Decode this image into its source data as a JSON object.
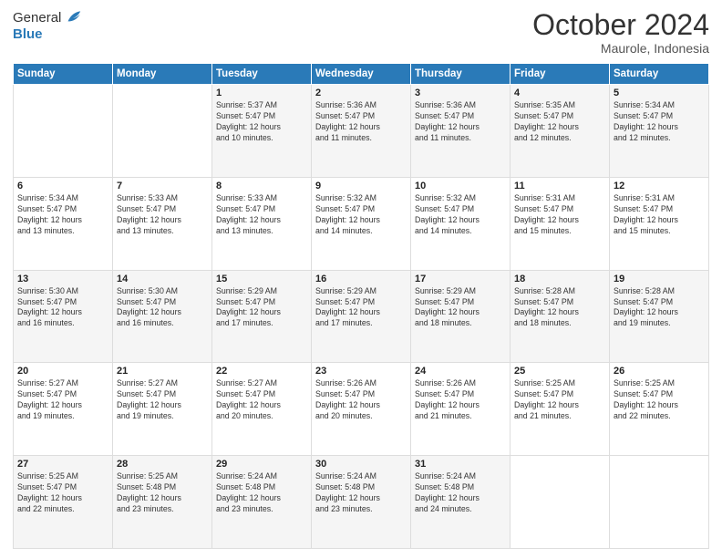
{
  "logo": {
    "text_general": "General",
    "text_blue": "Blue"
  },
  "header": {
    "month": "October 2024",
    "location": "Maurole, Indonesia"
  },
  "days_of_week": [
    "Sunday",
    "Monday",
    "Tuesday",
    "Wednesday",
    "Thursday",
    "Friday",
    "Saturday"
  ],
  "weeks": [
    [
      {
        "day": "",
        "sunrise": "",
        "sunset": "",
        "daylight": ""
      },
      {
        "day": "",
        "sunrise": "",
        "sunset": "",
        "daylight": ""
      },
      {
        "day": "1",
        "sunrise": "Sunrise: 5:37 AM",
        "sunset": "Sunset: 5:47 PM",
        "daylight": "Daylight: 12 hours and 10 minutes."
      },
      {
        "day": "2",
        "sunrise": "Sunrise: 5:36 AM",
        "sunset": "Sunset: 5:47 PM",
        "daylight": "Daylight: 12 hours and 11 minutes."
      },
      {
        "day": "3",
        "sunrise": "Sunrise: 5:36 AM",
        "sunset": "Sunset: 5:47 PM",
        "daylight": "Daylight: 12 hours and 11 minutes."
      },
      {
        "day": "4",
        "sunrise": "Sunrise: 5:35 AM",
        "sunset": "Sunset: 5:47 PM",
        "daylight": "Daylight: 12 hours and 12 minutes."
      },
      {
        "day": "5",
        "sunrise": "Sunrise: 5:34 AM",
        "sunset": "Sunset: 5:47 PM",
        "daylight": "Daylight: 12 hours and 12 minutes."
      }
    ],
    [
      {
        "day": "6",
        "sunrise": "Sunrise: 5:34 AM",
        "sunset": "Sunset: 5:47 PM",
        "daylight": "Daylight: 12 hours and 13 minutes."
      },
      {
        "day": "7",
        "sunrise": "Sunrise: 5:33 AM",
        "sunset": "Sunset: 5:47 PM",
        "daylight": "Daylight: 12 hours and 13 minutes."
      },
      {
        "day": "8",
        "sunrise": "Sunrise: 5:33 AM",
        "sunset": "Sunset: 5:47 PM",
        "daylight": "Daylight: 12 hours and 13 minutes."
      },
      {
        "day": "9",
        "sunrise": "Sunrise: 5:32 AM",
        "sunset": "Sunset: 5:47 PM",
        "daylight": "Daylight: 12 hours and 14 minutes."
      },
      {
        "day": "10",
        "sunrise": "Sunrise: 5:32 AM",
        "sunset": "Sunset: 5:47 PM",
        "daylight": "Daylight: 12 hours and 14 minutes."
      },
      {
        "day": "11",
        "sunrise": "Sunrise: 5:31 AM",
        "sunset": "Sunset: 5:47 PM",
        "daylight": "Daylight: 12 hours and 15 minutes."
      },
      {
        "day": "12",
        "sunrise": "Sunrise: 5:31 AM",
        "sunset": "Sunset: 5:47 PM",
        "daylight": "Daylight: 12 hours and 15 minutes."
      }
    ],
    [
      {
        "day": "13",
        "sunrise": "Sunrise: 5:30 AM",
        "sunset": "Sunset: 5:47 PM",
        "daylight": "Daylight: 12 hours and 16 minutes."
      },
      {
        "day": "14",
        "sunrise": "Sunrise: 5:30 AM",
        "sunset": "Sunset: 5:47 PM",
        "daylight": "Daylight: 12 hours and 16 minutes."
      },
      {
        "day": "15",
        "sunrise": "Sunrise: 5:29 AM",
        "sunset": "Sunset: 5:47 PM",
        "daylight": "Daylight: 12 hours and 17 minutes."
      },
      {
        "day": "16",
        "sunrise": "Sunrise: 5:29 AM",
        "sunset": "Sunset: 5:47 PM",
        "daylight": "Daylight: 12 hours and 17 minutes."
      },
      {
        "day": "17",
        "sunrise": "Sunrise: 5:29 AM",
        "sunset": "Sunset: 5:47 PM",
        "daylight": "Daylight: 12 hours and 18 minutes."
      },
      {
        "day": "18",
        "sunrise": "Sunrise: 5:28 AM",
        "sunset": "Sunset: 5:47 PM",
        "daylight": "Daylight: 12 hours and 18 minutes."
      },
      {
        "day": "19",
        "sunrise": "Sunrise: 5:28 AM",
        "sunset": "Sunset: 5:47 PM",
        "daylight": "Daylight: 12 hours and 19 minutes."
      }
    ],
    [
      {
        "day": "20",
        "sunrise": "Sunrise: 5:27 AM",
        "sunset": "Sunset: 5:47 PM",
        "daylight": "Daylight: 12 hours and 19 minutes."
      },
      {
        "day": "21",
        "sunrise": "Sunrise: 5:27 AM",
        "sunset": "Sunset: 5:47 PM",
        "daylight": "Daylight: 12 hours and 19 minutes."
      },
      {
        "day": "22",
        "sunrise": "Sunrise: 5:27 AM",
        "sunset": "Sunset: 5:47 PM",
        "daylight": "Daylight: 12 hours and 20 minutes."
      },
      {
        "day": "23",
        "sunrise": "Sunrise: 5:26 AM",
        "sunset": "Sunset: 5:47 PM",
        "daylight": "Daylight: 12 hours and 20 minutes."
      },
      {
        "day": "24",
        "sunrise": "Sunrise: 5:26 AM",
        "sunset": "Sunset: 5:47 PM",
        "daylight": "Daylight: 12 hours and 21 minutes."
      },
      {
        "day": "25",
        "sunrise": "Sunrise: 5:25 AM",
        "sunset": "Sunset: 5:47 PM",
        "daylight": "Daylight: 12 hours and 21 minutes."
      },
      {
        "day": "26",
        "sunrise": "Sunrise: 5:25 AM",
        "sunset": "Sunset: 5:47 PM",
        "daylight": "Daylight: 12 hours and 22 minutes."
      }
    ],
    [
      {
        "day": "27",
        "sunrise": "Sunrise: 5:25 AM",
        "sunset": "Sunset: 5:47 PM",
        "daylight": "Daylight: 12 hours and 22 minutes."
      },
      {
        "day": "28",
        "sunrise": "Sunrise: 5:25 AM",
        "sunset": "Sunset: 5:48 PM",
        "daylight": "Daylight: 12 hours and 23 minutes."
      },
      {
        "day": "29",
        "sunrise": "Sunrise: 5:24 AM",
        "sunset": "Sunset: 5:48 PM",
        "daylight": "Daylight: 12 hours and 23 minutes."
      },
      {
        "day": "30",
        "sunrise": "Sunrise: 5:24 AM",
        "sunset": "Sunset: 5:48 PM",
        "daylight": "Daylight: 12 hours and 23 minutes."
      },
      {
        "day": "31",
        "sunrise": "Sunrise: 5:24 AM",
        "sunset": "Sunset: 5:48 PM",
        "daylight": "Daylight: 12 hours and 24 minutes."
      },
      {
        "day": "",
        "sunrise": "",
        "sunset": "",
        "daylight": ""
      },
      {
        "day": "",
        "sunrise": "",
        "sunset": "",
        "daylight": ""
      }
    ]
  ]
}
